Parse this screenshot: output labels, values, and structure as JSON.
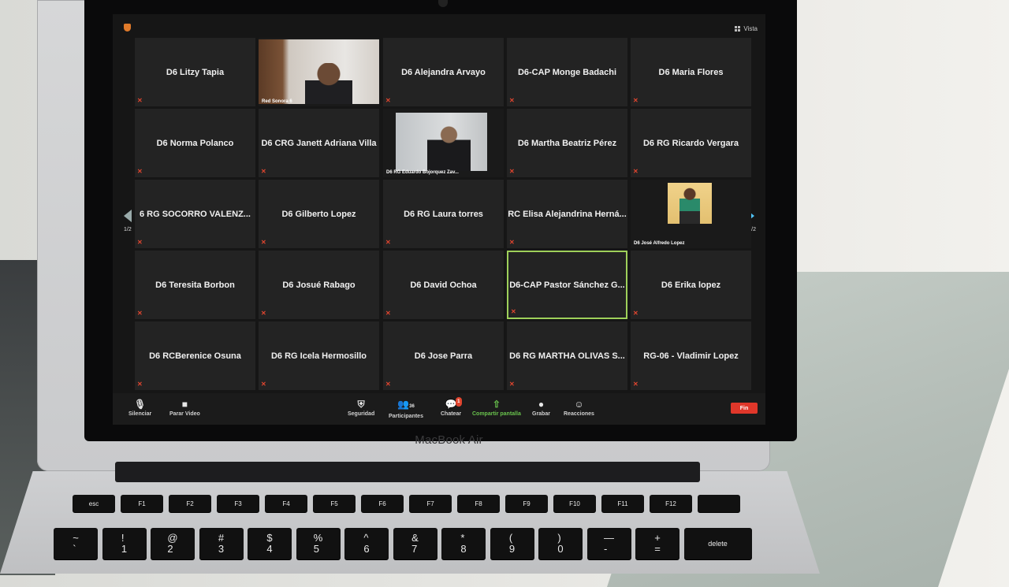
{
  "laptop": {
    "brand": "MacBook Air"
  },
  "meeting": {
    "view_label": "Vista",
    "page_indicator": "1/2",
    "participants": [
      {
        "name": "D6 Litzy Tapia",
        "video": false,
        "active": false
      },
      {
        "name": "Red Sonora 6",
        "video": true,
        "active": false
      },
      {
        "name": "D6 Alejandra Arvayo",
        "video": false,
        "active": false
      },
      {
        "name": "D6-CAP Monge Badachi",
        "video": false,
        "active": false
      },
      {
        "name": "D6 Maria Flores",
        "video": false,
        "active": false
      },
      {
        "name": "D6 Norma Polanco",
        "video": false,
        "active": false
      },
      {
        "name": "D6 CRG Janett Adriana Villa",
        "video": false,
        "active": false
      },
      {
        "name": "D6 RG Eduardo Bojorquez Zav...",
        "video": true,
        "active": false
      },
      {
        "name": "D6  Martha Beatriz Pérez",
        "video": false,
        "active": false
      },
      {
        "name": "D6 RG Ricardo Vergara",
        "video": false,
        "active": false
      },
      {
        "name": "6 RG SOCORRO VALENZ...",
        "video": false,
        "active": false
      },
      {
        "name": "D6 Gilberto Lopez",
        "video": false,
        "active": false
      },
      {
        "name": "D6 RG Laura torres",
        "video": false,
        "active": false
      },
      {
        "name": "RC Elisa Alejandrina Herná...",
        "video": false,
        "active": false
      },
      {
        "name": "D6 José Alfredo Lopez",
        "video": true,
        "active": false
      },
      {
        "name": "D6 Teresita Borbon",
        "video": false,
        "active": false
      },
      {
        "name": "D6 Josué Rabago",
        "video": false,
        "active": false
      },
      {
        "name": "D6 David Ochoa",
        "video": false,
        "active": false
      },
      {
        "name": "D6-CAP Pastor Sánchez G...",
        "video": false,
        "active": true
      },
      {
        "name": "D6 Erika lopez",
        "video": false,
        "active": false
      },
      {
        "name": "D6 RCBerenice Osuna",
        "video": false,
        "active": false
      },
      {
        "name": "D6 RG Icela Hermosillo",
        "video": false,
        "active": false
      },
      {
        "name": "D6 Jose Parra",
        "video": false,
        "active": false
      },
      {
        "name": "D6 RG MARTHA OLIVAS S...",
        "video": false,
        "active": false
      },
      {
        "name": "RG-06 - Vladimir Lopez",
        "video": false,
        "active": false
      }
    ],
    "toolbar": {
      "mute": "Silenciar",
      "stop_video": "Parar Video",
      "security": "Seguridad",
      "participants": "Participantes",
      "participants_count": "36",
      "chat": "Chatear",
      "chat_badge": "1",
      "share_screen": "Compartir pantalla",
      "record": "Grabar",
      "reactions": "Reacciones",
      "end": "Fin"
    }
  },
  "keyboard": {
    "row1": [
      "esc",
      "F1",
      "F2",
      "F3",
      "F4",
      "F5",
      "F6",
      "F7",
      "F8",
      "F9",
      "F10",
      "F11",
      "F12",
      ""
    ],
    "row2": [
      "~\n`",
      "!\n1",
      "@\n2",
      "#\n3",
      "$\n4",
      "%\n5",
      "^\n6",
      "&\n7",
      "*\n8",
      "(\n9",
      ")\n0",
      "—\n-",
      "+\n=",
      "delete"
    ]
  }
}
